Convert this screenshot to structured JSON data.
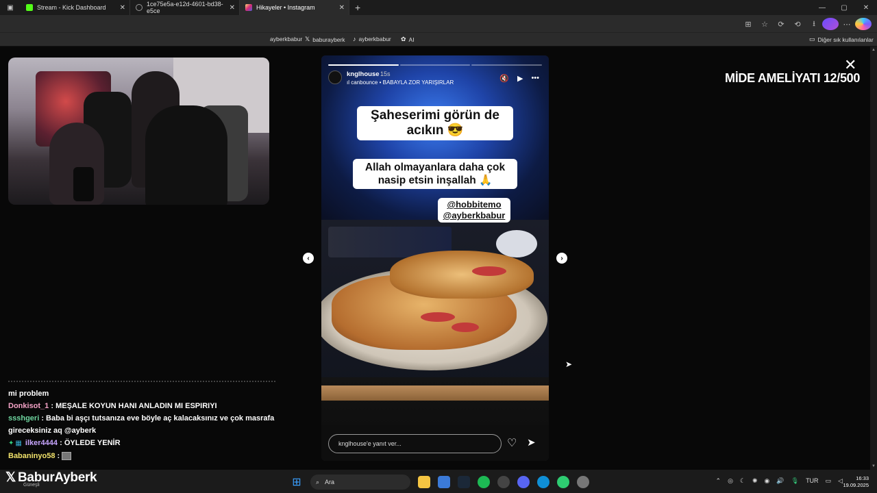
{
  "browser": {
    "tabs": [
      {
        "title": "Stream - Kick Dashboard",
        "icon": "kick-icon",
        "color": "#53fc18"
      },
      {
        "title": "1ce75e5a-e12d-4601-bd38-e5ce",
        "icon": "globe-icon",
        "color": "#999999"
      },
      {
        "title": "Hikayeler • Instagram",
        "icon": "instagram-icon",
        "color": "#e1306c"
      }
    ],
    "new_tab": "+",
    "window_controls": {
      "minimize": "—",
      "maximize": "▢",
      "close": "✕"
    },
    "bookmarks": [
      {
        "label": "ayberkbabur",
        "icon": "instagram-icon"
      },
      {
        "label": "baburayberk",
        "icon": "x-icon"
      },
      {
        "label": "ayberkbabur",
        "icon": "tiktok-icon"
      },
      {
        "label": "AI",
        "icon": "openai-icon"
      }
    ],
    "other_bookmarks": "Diğer sık kullanılanlar"
  },
  "story": {
    "username": "knglhouse",
    "age": "15s",
    "music": "canbounce • BABAYLA ZOR YARIŞIRLAR",
    "progress": {
      "segments": 3,
      "current": 1,
      "current_fill": 1.0
    },
    "sticker_1": "Şaheserimi görün de acıkın 😎",
    "sticker_2": "Allah olmayanlara daha çok nasip etsin inşallah 🙏",
    "mention_1": "@hobbitemo",
    "mention_2": "@ayberkbabur",
    "reply_placeholder": "knglhouse'e yanıt ver...",
    "controls": {
      "mute": "🔇",
      "play": "▶",
      "more": "•••"
    },
    "heart": "♡",
    "send": "➤",
    "prev": "‹",
    "next": "›"
  },
  "overlay_text": "MİDE AMELİYATI 12/500",
  "close": "✕",
  "chat": [
    {
      "user": "",
      "message": "mi problem",
      "user_color": "#ffffff"
    },
    {
      "user": "Donkisot_1",
      "message": "MEŞALE KOYUN HANI ANLADIN MI ESPIRIYI",
      "user_color": "#f5a3c7"
    },
    {
      "user": "ssshgeri",
      "message": "Baba bi aşçı tutsanıza eve böyle aç kalacaksınız ve çok masrafa gireceksiniz aq @ayberk",
      "user_color": "#6fd6a0"
    },
    {
      "user": "ilker4444",
      "message": "ÖYLEDE YENİR",
      "user_color": "#c8a6ff",
      "badge": "✦"
    },
    {
      "user": "Babaninyo58",
      "message": "",
      "user_color": "#f2e36b",
      "image": true
    }
  ],
  "streamer": {
    "brand": "BaburAyberk",
    "weather": "Güneşli"
  },
  "taskbar": {
    "search": "Ara",
    "language": "TUR",
    "time": "16:33",
    "date": "19.09.2025"
  }
}
